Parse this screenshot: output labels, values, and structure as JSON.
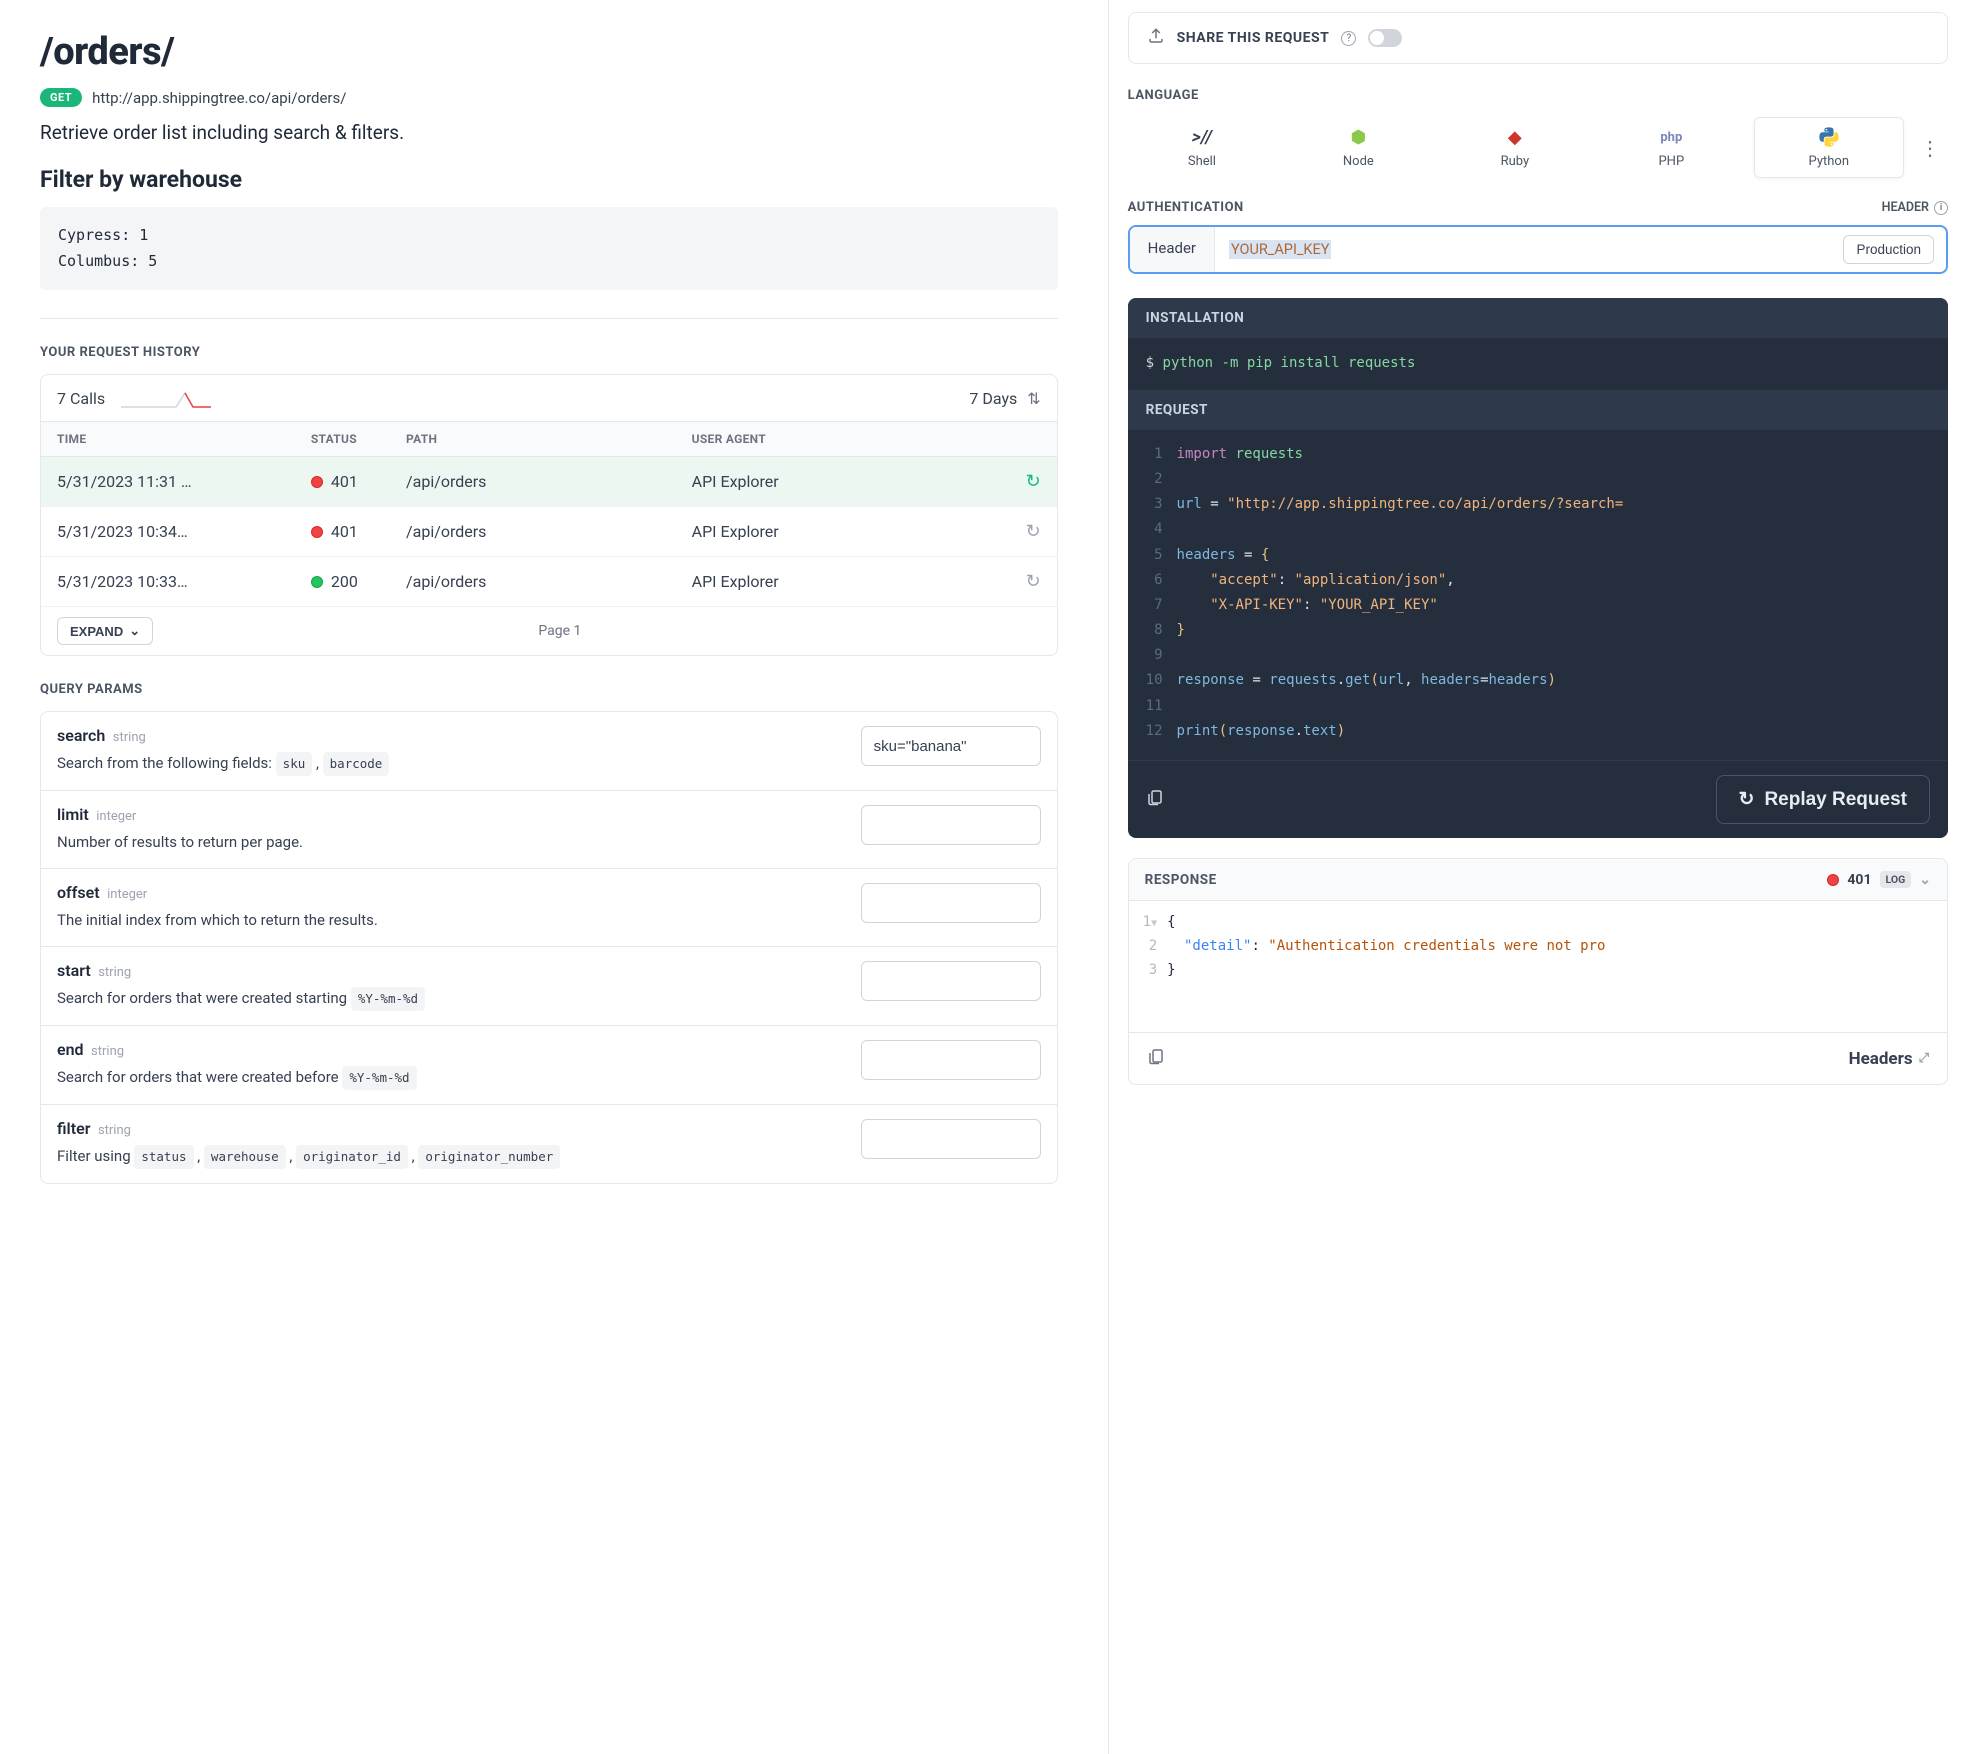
{
  "page": {
    "title": "/orders/",
    "method_badge": "GET",
    "url": "http://app.shippingtree.co/api/orders/",
    "description": "Retrieve order list including search & filters.",
    "filter_heading": "Filter by warehouse",
    "filter_code": "Cypress: 1\nColumbus: 5"
  },
  "history": {
    "section_label": "YOUR REQUEST HISTORY",
    "calls_label": "7 Calls",
    "range_label": "7 Days",
    "columns": {
      "time": "TIME",
      "status": "STATUS",
      "path": "PATH",
      "user_agent": "USER AGENT"
    },
    "rows": [
      {
        "time": "5/31/2023 11:31 …",
        "status": "401",
        "color": "red",
        "path": "/api/orders",
        "agent": "API Explorer",
        "selected": true
      },
      {
        "time": "5/31/2023 10:34…",
        "status": "401",
        "color": "red",
        "path": "/api/orders",
        "agent": "API Explorer",
        "selected": false
      },
      {
        "time": "5/31/2023 10:33…",
        "status": "200",
        "color": "green",
        "path": "/api/orders",
        "agent": "API Explorer",
        "selected": false
      }
    ],
    "expand_label": "EXPAND",
    "page_label": "Page 1"
  },
  "query_params": {
    "section_label": "QUERY PARAMS",
    "params": [
      {
        "name": "search",
        "type": "string",
        "desc": "Search from the following fields:",
        "tags": [
          "sku",
          "barcode"
        ],
        "value": "sku=\"banana\""
      },
      {
        "name": "limit",
        "type": "integer",
        "desc": "Number of results to return per page.",
        "tags": [],
        "value": ""
      },
      {
        "name": "offset",
        "type": "integer",
        "desc": "The initial index from which to return the results.",
        "tags": [],
        "value": ""
      },
      {
        "name": "start",
        "type": "string",
        "desc": "Search for orders that were created starting",
        "tags": [
          "%Y-%m-%d"
        ],
        "value": ""
      },
      {
        "name": "end",
        "type": "string",
        "desc": "Search for orders that were created before",
        "tags": [
          "%Y-%m-%d"
        ],
        "value": ""
      },
      {
        "name": "filter",
        "type": "string",
        "desc": "Filter using",
        "tags": [
          "status",
          "warehouse",
          "originator_id",
          "originator_number"
        ],
        "value": ""
      }
    ]
  },
  "share": {
    "label": "SHARE THIS REQUEST"
  },
  "language": {
    "section_label": "LANGUAGE",
    "items": [
      {
        "name": "Shell",
        "icon": ">//",
        "color": "#374151"
      },
      {
        "name": "Node",
        "icon": "⬢",
        "color": "#8cc84b"
      },
      {
        "name": "Ruby",
        "icon": "◆",
        "color": "#cc342d"
      },
      {
        "name": "PHP",
        "icon": "php",
        "color": "#7a86b8"
      },
      {
        "name": "Python",
        "icon": "🐍",
        "color": "#3776ab"
      }
    ],
    "active": "Python"
  },
  "auth": {
    "section_label": "AUTHENTICATION",
    "type_label": "HEADER",
    "left_label": "Header",
    "value": "YOUR_API_KEY",
    "env_button": "Production"
  },
  "code": {
    "installation_label": "INSTALLATION",
    "install_line": "python -m pip install requests",
    "request_label": "REQUEST",
    "url_str": "\"http://app.shippingtree.co/api/orders/?search=",
    "replay_label": "Replay Request"
  },
  "response": {
    "label": "RESPONSE",
    "status": "401",
    "log_badge": "LOG",
    "detail_key": "\"detail\"",
    "detail_val": "\"Authentication credentials were not pro",
    "headers_label": "Headers"
  }
}
